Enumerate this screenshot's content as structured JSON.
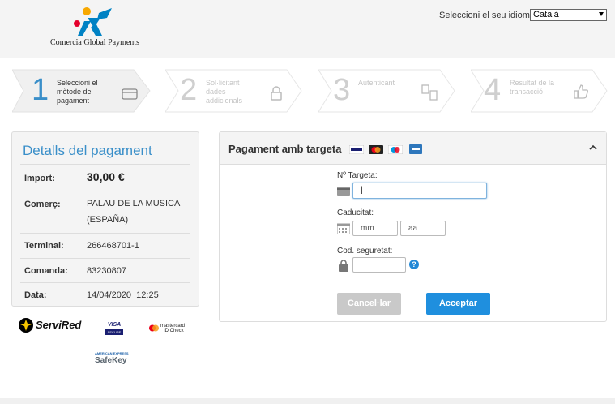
{
  "header": {
    "brand": "Comercia Global Payments",
    "language_label": "Seleccioni el seu idioma",
    "language_value": "Català"
  },
  "steps": [
    {
      "number": "1",
      "label": "Seleccioni el mètode de pagament",
      "active": true
    },
    {
      "number": "2",
      "label": "Sol·licitant dades addicionals",
      "active": false
    },
    {
      "number": "3",
      "label": "Autenticant",
      "active": false
    },
    {
      "number": "4",
      "label": "Resultat de la transacció",
      "active": false
    }
  ],
  "details": {
    "title": "Detalls del pagament",
    "rows": [
      {
        "key": "Import:",
        "value": "30,00 €"
      },
      {
        "key": "Comerç:",
        "value": "PALAU DE LA MUSICA (ESPAÑA)"
      },
      {
        "key": "Terminal:",
        "value": "266468701-1"
      },
      {
        "key": "Comanda:",
        "value": "83230807"
      },
      {
        "key": "Data:",
        "value": "14/04/2020  12:25"
      }
    ]
  },
  "badges": {
    "servired": "ServiRed",
    "visa": "VISA",
    "visa_sub": "SECURE",
    "mastercard": "mastercard",
    "mastercard_sub": "ID Check",
    "amex_top": "AMERICAN EXPRESS",
    "safekey": "SafeKey"
  },
  "payment": {
    "title": "Pagament amb targeta",
    "card_label": "Nº Targeta:",
    "card_value": "|",
    "expiry_label": "Caducitat:",
    "month_placeholder": "mm",
    "year_placeholder": "aa",
    "cvv_label": "Cod. seguretat:",
    "help": "?",
    "cancel": "Cancel·lar",
    "accept": "Acceptar"
  },
  "colors": {
    "accent": "#3a8fc9",
    "accept_button": "#1f8fde",
    "cancel_button": "#c9c9c9"
  }
}
